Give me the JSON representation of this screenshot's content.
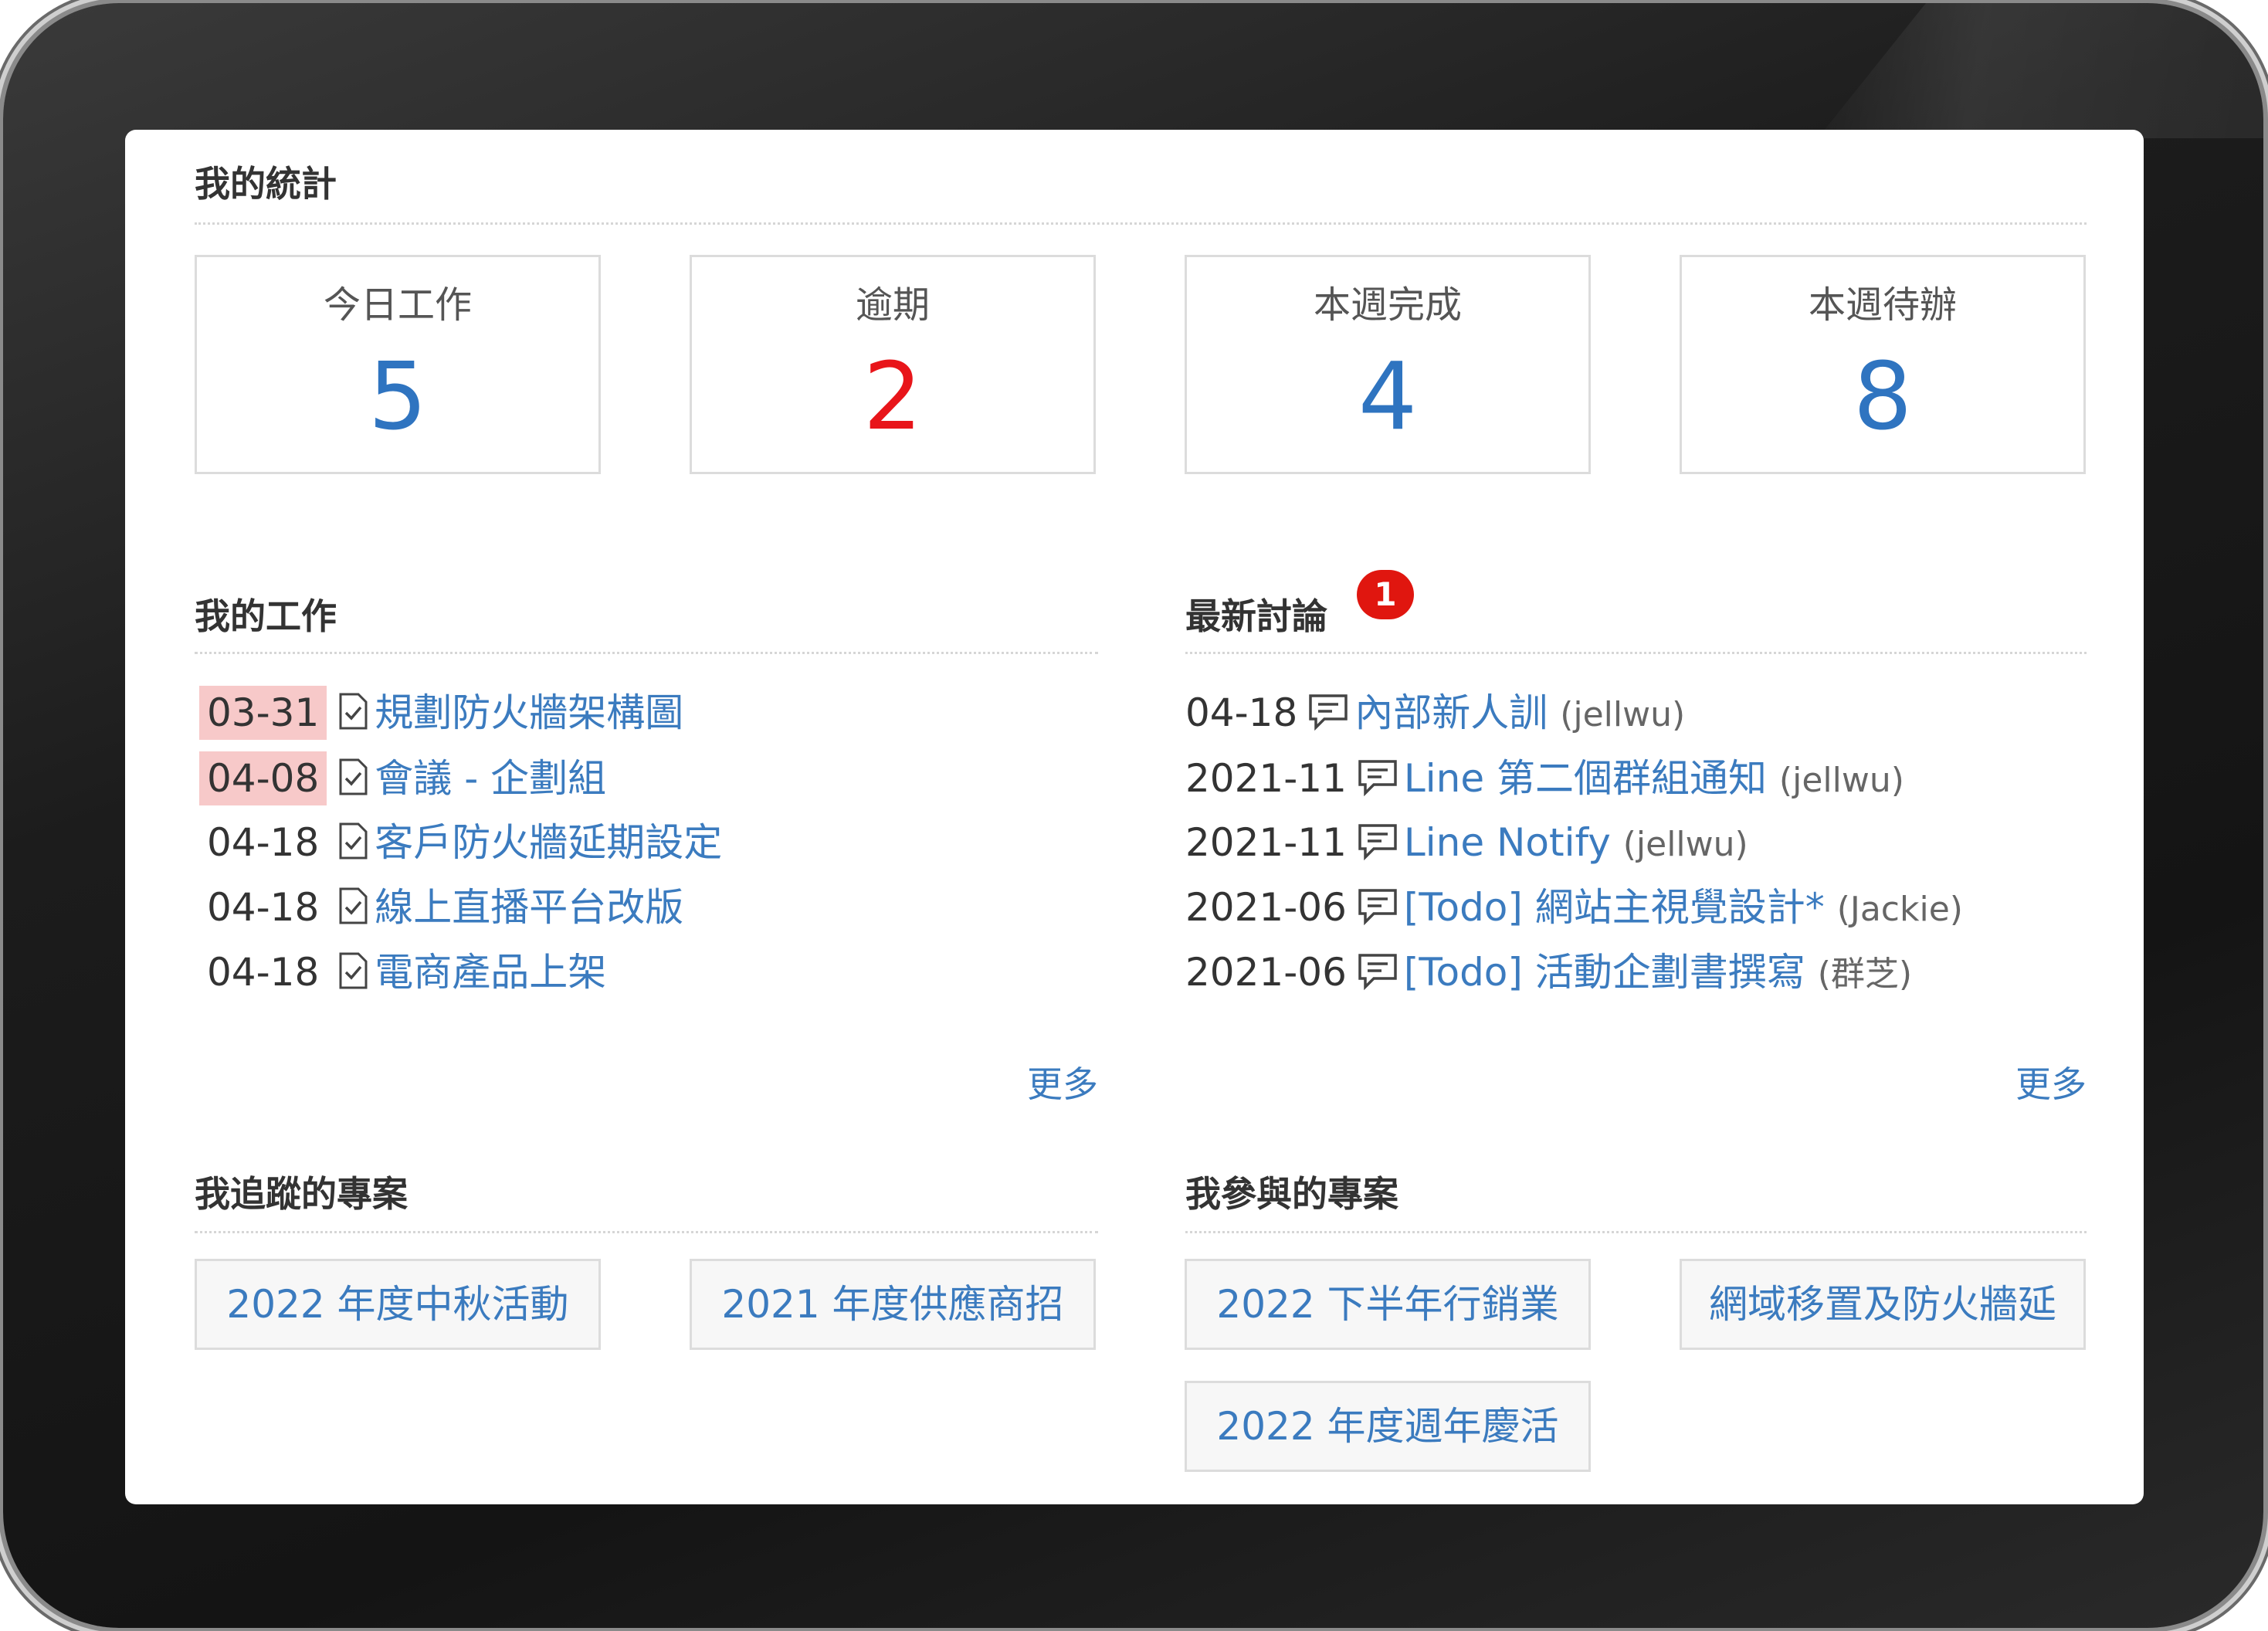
{
  "stats": {
    "title": "我的統計",
    "cards": [
      {
        "label": "今日工作",
        "value": "5",
        "color": "#2f74c0"
      },
      {
        "label": "逾期",
        "value": "2",
        "color": "#e8151a"
      },
      {
        "label": "本週完成",
        "value": "4",
        "color": "#2f74c0"
      },
      {
        "label": "本週待辦",
        "value": "8",
        "color": "#2f74c0"
      }
    ]
  },
  "my_work": {
    "title": "我的工作",
    "more": "更多",
    "items": [
      {
        "date": "03-31",
        "title": "規劃防火牆架構圖",
        "overdue": true
      },
      {
        "date": "04-08",
        "title": "會議 - 企劃組",
        "overdue": true
      },
      {
        "date": "04-18",
        "title": "客戶防火牆延期設定",
        "overdue": false
      },
      {
        "date": "04-18",
        "title": "線上直播平台改版",
        "overdue": false
      },
      {
        "date": "04-18",
        "title": "電商產品上架",
        "overdue": false
      }
    ]
  },
  "discussions": {
    "title": "最新討論",
    "badge": "1",
    "more": "更多",
    "items": [
      {
        "date": "04-18",
        "title": "內部新人訓",
        "author": "(jellwu)"
      },
      {
        "date": "2021-11",
        "title": "Line 第二個群組通知",
        "author": "(jellwu)"
      },
      {
        "date": "2021-11",
        "title": "Line Notify",
        "author": "(jellwu)"
      },
      {
        "date": "2021-06",
        "title": "[Todo] 網站主視覺設計*",
        "author": "(Jackie)"
      },
      {
        "date": "2021-06",
        "title": "[Todo] 活動企劃書撰寫",
        "author": "(群芝)"
      }
    ]
  },
  "followed_projects": {
    "title": "我追蹤的專案",
    "items": [
      "2022 年度中秋活動",
      "2021 年度供應商招"
    ]
  },
  "joined_projects": {
    "title": "我參與的專案",
    "items": [
      "2022 下半年行銷業",
      "網域移置及防火牆延",
      "2022 年度週年慶活"
    ]
  }
}
